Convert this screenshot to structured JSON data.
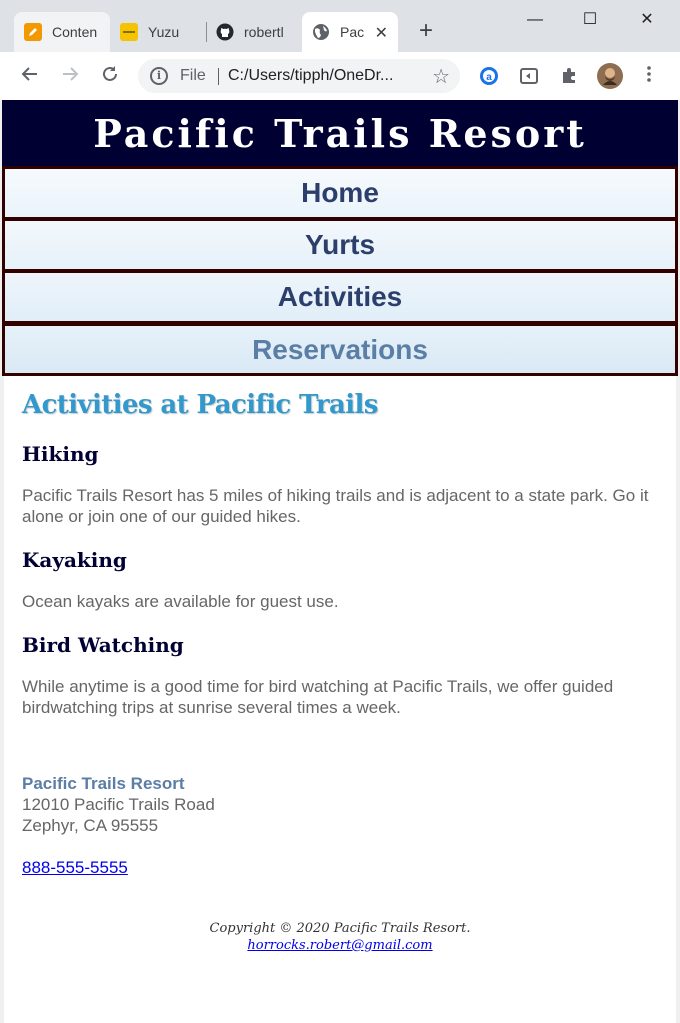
{
  "browser": {
    "tabs": [
      {
        "title": "Conten",
        "icon": "pencil-icon"
      },
      {
        "title": "Yuzu",
        "icon": "yuzu-icon"
      },
      {
        "title": "robertl",
        "icon": "github-icon"
      },
      {
        "title": "Pac",
        "icon": "globe-icon",
        "active": true
      }
    ],
    "new_tab_label": "+",
    "minimize": "—",
    "maximize": "☐",
    "close": "✕",
    "address": {
      "scheme_label": "File",
      "url": "C:/Users/tipph/OneDr..."
    }
  },
  "site": {
    "title": "Pacific Trails Resort",
    "nav": [
      "Home",
      "Yurts",
      "Activities",
      "Reservations"
    ]
  },
  "main": {
    "heading": "Activities at Pacific Trails",
    "sections": [
      {
        "title": "Hiking",
        "text": "Pacific Trails Resort has 5 miles of hiking trails and is adjacent to a state park. Go it alone or join one of our guided hikes."
      },
      {
        "title": "Kayaking",
        "text": "Ocean kayaks are available for guest use."
      },
      {
        "title": "Bird Watching",
        "text": "While anytime is a good time for bird watching at Pacific Trails, we offer guided birdwatching trips at sunrise several times a week."
      }
    ]
  },
  "contact": {
    "name": "Pacific Trails Resort",
    "street": "12010 Pacific Trails Road",
    "city": "Zephyr, CA 95555",
    "phone": "888-555-5555"
  },
  "footer": {
    "copyright": "Copyright © 2020 Pacific Trails Resort.",
    "email": "horrocks.robert@gmail.com"
  },
  "colors": {
    "header_bg": "#000033",
    "nav_border": "#330000",
    "heading": "#3399cc",
    "nav_text": "#2c3e6b",
    "body_text": "#666666"
  }
}
